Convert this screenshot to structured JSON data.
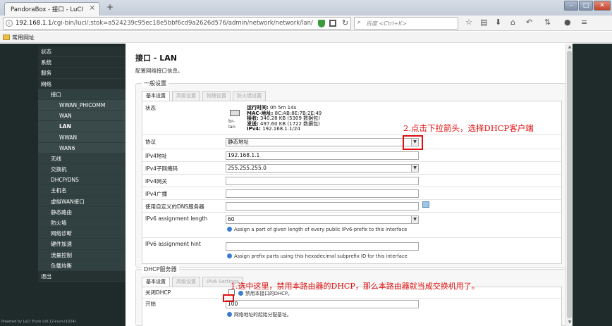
{
  "browser": {
    "tab_title": "PandoraBox - 接口 - LuCI",
    "tab_close": "×",
    "new_tab": "+",
    "url_host": "192.168.1.1",
    "url_path": "/cgi-bin/luci/;stok=a524239c95ec18e5bbf6cd9a2626d576/admin/network/network/lan/",
    "search_placeholder": "百度 <Ctrl+K>",
    "bookmark": "常用网址",
    "win_min": "–",
    "win_max": "□",
    "win_close": "✕"
  },
  "sidebar": {
    "items": [
      {
        "label": "状态",
        "level": 0
      },
      {
        "label": "系统",
        "level": 0
      },
      {
        "label": "服务",
        "level": 0
      },
      {
        "label": "网络",
        "level": 0
      },
      {
        "label": "接口",
        "level": 1
      },
      {
        "label": "WWAN_PHICOMM",
        "level": 2
      },
      {
        "label": "WAN",
        "level": 2
      },
      {
        "label": "LAN",
        "level": 2,
        "active": true
      },
      {
        "label": "WWAN",
        "level": 2
      },
      {
        "label": "WAN6",
        "level": 2
      },
      {
        "label": "无线",
        "level": 1
      },
      {
        "label": "交换机",
        "level": 1
      },
      {
        "label": "DHCP/DNS",
        "level": 1
      },
      {
        "label": "主机名",
        "level": 1
      },
      {
        "label": "虚拟WAN接口",
        "level": 1
      },
      {
        "label": "静态路由",
        "level": 1
      },
      {
        "label": "防火墙",
        "level": 1
      },
      {
        "label": "网络诊断",
        "level": 1
      },
      {
        "label": "硬件加速",
        "level": 1
      },
      {
        "label": "流量控制",
        "level": 1
      },
      {
        "label": "负载均衡",
        "level": 1
      },
      {
        "label": "退出",
        "level": 0
      }
    ],
    "powered_by": "Powered by LuCI Trunk (v0.12+svn-r1024)"
  },
  "page": {
    "title": "接口 - LAN",
    "description": "配置网络接口信息。"
  },
  "general": {
    "legend": "一般设置",
    "tabs": [
      "基本设置",
      "高级设置",
      "物理设置",
      "防火墙设置"
    ],
    "status": {
      "label": "状态",
      "iface": "br-lan",
      "uptime_label": "运行时间:",
      "uptime": "0h 5m 14s",
      "mac_label": "MAC-地址:",
      "mac": "8C:AB:8E:7B:2E:49",
      "rx_label": "接收:",
      "rx": "340.28 KB (5309 数据包)",
      "tx_label": "发送:",
      "tx": "497.60 KB (1722 数据包)",
      "ipv4_label": "IPv4:",
      "ipv4": "192.168.1.1/24"
    },
    "protocol": {
      "label": "协议",
      "value": "静态地址"
    },
    "ipv4addr": {
      "label": "IPv4地址",
      "value": "192.168.1.1"
    },
    "netmask": {
      "label": "IPv4子网掩码",
      "value": "255.255.255.0"
    },
    "gateway": {
      "label": "IPv4网关",
      "value": ""
    },
    "broadcast": {
      "label": "IPv4广播",
      "value": ""
    },
    "dns": {
      "label": "使用自定义的DNS服务器",
      "value": ""
    },
    "ip6assign": {
      "label": "IPv6 assignment length",
      "value": "60",
      "hint": "Assign a part of given length of every public IPv6-prefix to this interface"
    },
    "ip6hint": {
      "label": "IPv6 assignment hint",
      "value": "",
      "hint": "Assign prefix parts using this hexadecimal subprefix ID for this interface"
    }
  },
  "dhcp": {
    "legend": "DHCP服务器",
    "tabs": [
      "基本设置",
      "高级设置",
      "IPv6 Settings"
    ],
    "disable": {
      "label": "关闭DHCP",
      "hint": "禁用本接口的DHCP。"
    },
    "start": {
      "label": "开始",
      "value": "100",
      "hint": "网络地址的起始分配基址。"
    }
  },
  "annotations": {
    "note2": "2.点击下拉箭头，选择DHCP客户端",
    "note1": "1.选中这里，禁用本路由器的DHCP，那么本路由器就当成交换机用了。"
  },
  "colors": {
    "annotation": "#e01010",
    "sidebar_bg": "#1f2a2a",
    "hint_icon": "#3a7bd5"
  }
}
